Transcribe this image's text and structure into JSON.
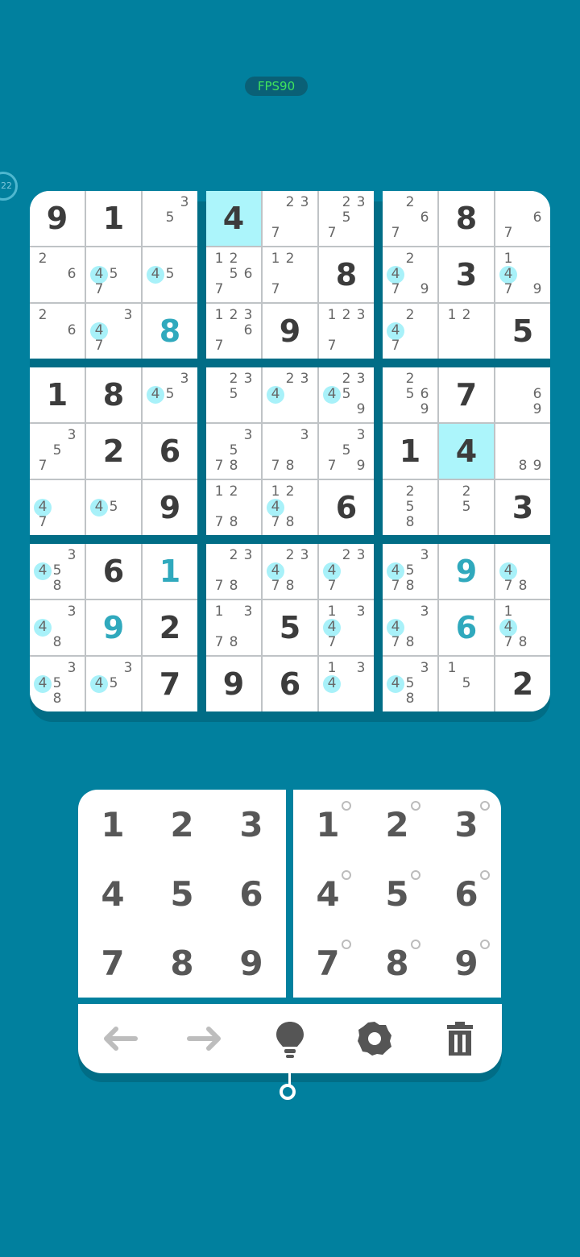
{
  "status": {
    "fps_label": "FPS90",
    "timer_label": "22"
  },
  "board": {
    "rows": [
      [
        {
          "v": "9",
          "t": "g"
        },
        {
          "v": "1",
          "t": "g"
        },
        {
          "n": [
            "",
            "",
            "3",
            "",
            "5",
            "",
            "",
            "",
            ""
          ]
        },
        {
          "v": "4",
          "t": "g",
          "hl": true
        },
        {
          "n": [
            "",
            "2",
            "3",
            "",
            "",
            "",
            "7",
            "",
            ""
          ]
        },
        {
          "n": [
            "",
            "2",
            "3",
            "",
            "5",
            "",
            "7",
            "",
            ""
          ]
        },
        {
          "n": [
            "",
            "2",
            "",
            "",
            "",
            "6",
            "7",
            "",
            ""
          ]
        },
        {
          "v": "8",
          "t": "g"
        },
        {
          "n": [
            "",
            "",
            "",
            "",
            "",
            "6",
            "7",
            "",
            ""
          ]
        }
      ],
      [
        {
          "n": [
            "2",
            "",
            "",
            "",
            "",
            "6",
            "",
            "",
            ""
          ]
        },
        {
          "n": [
            "",
            "",
            "",
            "4*",
            "5",
            "",
            "7",
            "",
            ""
          ]
        },
        {
          "n": [
            "",
            "",
            "",
            "4*",
            "5",
            "",
            "",
            "",
            ""
          ]
        },
        {
          "n": [
            "1",
            "2",
            "",
            "",
            "5",
            "6",
            "7",
            "",
            ""
          ]
        },
        {
          "n": [
            "1",
            "2",
            "",
            "",
            "",
            "",
            "7",
            "",
            ""
          ]
        },
        {
          "v": "8",
          "t": "g"
        },
        {
          "n": [
            "",
            "2",
            "",
            "4*",
            "",
            "",
            "7",
            "",
            "9"
          ]
        },
        {
          "v": "3",
          "t": "g"
        },
        {
          "n": [
            "1",
            "",
            "",
            "4*",
            "",
            "",
            "7",
            "",
            "9"
          ]
        }
      ],
      [
        {
          "n": [
            "2",
            "",
            "",
            "",
            "",
            "6",
            "",
            "",
            ""
          ]
        },
        {
          "n": [
            "",
            "",
            "3",
            "4*",
            "",
            "",
            "7",
            "",
            ""
          ]
        },
        {
          "v": "8",
          "t": "u"
        },
        {
          "n": [
            "1",
            "2",
            "3",
            "",
            "",
            "6",
            "7",
            "",
            ""
          ]
        },
        {
          "v": "9",
          "t": "g"
        },
        {
          "n": [
            "1",
            "2",
            "3",
            "",
            "",
            "",
            "7",
            "",
            ""
          ]
        },
        {
          "n": [
            "",
            "2",
            "",
            "4*",
            "",
            "",
            "7",
            "",
            ""
          ]
        },
        {
          "n": [
            "1",
            "2",
            "",
            "",
            "",
            "",
            "",
            "",
            ""
          ]
        },
        {
          "v": "5",
          "t": "g"
        }
      ],
      [
        {
          "v": "1",
          "t": "g"
        },
        {
          "v": "8",
          "t": "g"
        },
        {
          "n": [
            "",
            "",
            "3",
            "4*",
            "5",
            "",
            "",
            "",
            ""
          ]
        },
        {
          "n": [
            "",
            "2",
            "3",
            "",
            "5",
            "",
            "",
            "",
            ""
          ]
        },
        {
          "n": [
            "",
            "2",
            "3",
            "4*",
            "",
            "",
            "",
            "",
            ""
          ]
        },
        {
          "n": [
            "",
            "2",
            "3",
            "4*",
            "5",
            "",
            "",
            "",
            "9"
          ]
        },
        {
          "n": [
            "",
            "2",
            "",
            "",
            "5",
            "6",
            "",
            "",
            "9"
          ]
        },
        {
          "v": "7",
          "t": "g"
        },
        {
          "n": [
            "",
            "",
            "",
            "",
            "",
            "6",
            "",
            "",
            "9"
          ]
        }
      ],
      [
        {
          "n": [
            "",
            "",
            "3",
            "",
            "5",
            "",
            "7",
            "",
            ""
          ]
        },
        {
          "v": "2",
          "t": "g"
        },
        {
          "v": "6",
          "t": "g"
        },
        {
          "n": [
            "",
            "",
            "3",
            "",
            "5",
            "",
            "7",
            "8",
            ""
          ]
        },
        {
          "n": [
            "",
            "",
            "3",
            "",
            "",
            "",
            "7",
            "8",
            ""
          ]
        },
        {
          "n": [
            "",
            "",
            "3",
            "",
            "5",
            "",
            "7",
            "",
            "9"
          ]
        },
        {
          "v": "1",
          "t": "g"
        },
        {
          "v": "4",
          "t": "g",
          "hl": true
        },
        {
          "n": [
            "",
            "",
            "",
            "",
            "",
            "",
            "",
            "8",
            "9"
          ]
        }
      ],
      [
        {
          "n": [
            "",
            "",
            "",
            "4*",
            "",
            "",
            "7",
            "",
            ""
          ]
        },
        {
          "n": [
            "",
            "",
            "",
            "4*",
            "5",
            "",
            "",
            "",
            ""
          ]
        },
        {
          "v": "9",
          "t": "g"
        },
        {
          "n": [
            "1",
            "2",
            "",
            "",
            "",
            "",
            "7",
            "8",
            ""
          ]
        },
        {
          "n": [
            "1",
            "2",
            "",
            "4*",
            "",
            "",
            "7",
            "8",
            ""
          ]
        },
        {
          "v": "6",
          "t": "g"
        },
        {
          "n": [
            "",
            "2",
            "",
            "",
            "5",
            "",
            "",
            "8",
            ""
          ]
        },
        {
          "n": [
            "",
            "2",
            "",
            "",
            "5",
            "",
            "",
            "",
            ""
          ]
        },
        {
          "v": "3",
          "t": "g"
        }
      ],
      [
        {
          "n": [
            "",
            "",
            "3",
            "4*",
            "5",
            "",
            "",
            "8",
            ""
          ]
        },
        {
          "v": "6",
          "t": "g"
        },
        {
          "v": "1",
          "t": "u"
        },
        {
          "n": [
            "",
            "2",
            "3",
            "",
            "",
            "",
            "7",
            "8",
            ""
          ]
        },
        {
          "n": [
            "",
            "2",
            "3",
            "4*",
            "",
            "",
            "7",
            "8",
            ""
          ]
        },
        {
          "n": [
            "",
            "2",
            "3",
            "4*",
            "",
            "",
            "7",
            "",
            ""
          ]
        },
        {
          "n": [
            "",
            "",
            "3",
            "4*",
            "5",
            "",
            "7",
            "8",
            ""
          ]
        },
        {
          "v": "9",
          "t": "u"
        },
        {
          "n": [
            "",
            "",
            "",
            "4*",
            "",
            "",
            "7",
            "8",
            ""
          ]
        }
      ],
      [
        {
          "n": [
            "",
            "",
            "3",
            "4*",
            "",
            "",
            "",
            "8",
            ""
          ]
        },
        {
          "v": "9",
          "t": "u"
        },
        {
          "v": "2",
          "t": "g"
        },
        {
          "n": [
            "1",
            "",
            "3",
            "",
            "",
            "",
            "7",
            "8",
            ""
          ]
        },
        {
          "v": "5",
          "t": "g"
        },
        {
          "n": [
            "1",
            "",
            "3",
            "4*",
            "",
            "",
            "7",
            "",
            ""
          ]
        },
        {
          "n": [
            "",
            "",
            "3",
            "4*",
            "",
            "",
            "7",
            "8",
            ""
          ]
        },
        {
          "v": "6",
          "t": "u"
        },
        {
          "n": [
            "1",
            "",
            "",
            "4*",
            "",
            "",
            "7",
            "8",
            ""
          ]
        }
      ],
      [
        {
          "n": [
            "",
            "",
            "3",
            "4*",
            "5",
            "",
            "",
            "8",
            ""
          ]
        },
        {
          "n": [
            "",
            "",
            "3",
            "4*",
            "5",
            "",
            "",
            "",
            ""
          ]
        },
        {
          "v": "7",
          "t": "g"
        },
        {
          "v": "9",
          "t": "g"
        },
        {
          "v": "6",
          "t": "g"
        },
        {
          "n": [
            "1",
            "",
            "3",
            "4*",
            "",
            "",
            "",
            "",
            ""
          ]
        },
        {
          "n": [
            "",
            "",
            "3",
            "4*",
            "5",
            "",
            "",
            "8",
            ""
          ]
        },
        {
          "n": [
            "1",
            "",
            "",
            "",
            "5",
            "",
            "",
            "",
            ""
          ]
        },
        {
          "v": "2",
          "t": "g"
        }
      ]
    ]
  },
  "numpad": {
    "digits": [
      "1",
      "2",
      "3",
      "4",
      "5",
      "6",
      "7",
      "8",
      "9"
    ]
  },
  "notepad": {
    "digits": [
      "1",
      "2",
      "3",
      "4",
      "5",
      "6",
      "7",
      "8",
      "9"
    ]
  },
  "toolbar": {
    "buttons": [
      {
        "name": "undo-button",
        "icon": "arrow-left-icon"
      },
      {
        "name": "redo-button",
        "icon": "arrow-right-icon"
      },
      {
        "name": "hint-button",
        "icon": "lightbulb-icon"
      },
      {
        "name": "settings-button",
        "icon": "gear-icon"
      },
      {
        "name": "delete-button",
        "icon": "trash-icon"
      }
    ]
  },
  "colors": {
    "background": "#01809e",
    "highlight": "#acf5fb",
    "given": "#3c3c3c",
    "user": "#30a9bd",
    "note_highlight": "#a8f1f9",
    "fps_text": "#3fe35c"
  }
}
